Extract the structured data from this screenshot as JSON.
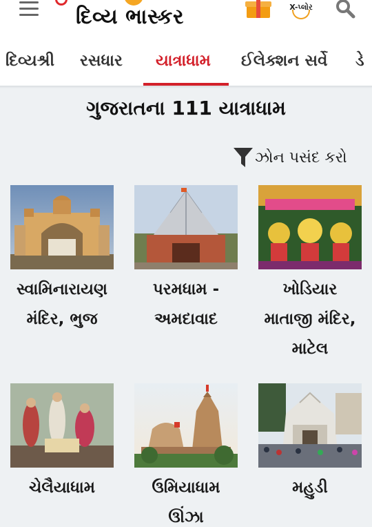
{
  "header": {
    "logo_text": "દિવ્ય ભાસ્કર",
    "xplore_text": "X-પ્લોર"
  },
  "tabs": [
    {
      "label": "દિવ્યશ્રી",
      "active": false
    },
    {
      "label": "રસધાર",
      "active": false
    },
    {
      "label": "યાત્રાધામ",
      "active": true
    },
    {
      "label": "ઈલેક્શન સર્વે",
      "active": false
    },
    {
      "label": "ડે",
      "active": false
    }
  ],
  "page": {
    "title": "ગુજરાતના 111 યાત્રાધામ",
    "filter_label": "ઝોન પસંદ કરો"
  },
  "temples": [
    {
      "line1": "સ્વામિનારાયણ",
      "line2": "મંદિર, ભુજ",
      "line3": ""
    },
    {
      "line1": "પરમધામ -",
      "line2": "અમદાવાદ",
      "line3": ""
    },
    {
      "line1": "ખોડિયાર",
      "line2": "માતાજી મંદિર,",
      "line3": "માટેલ"
    },
    {
      "line1": "ચેલૈયાધામ",
      "line2": "",
      "line3": ""
    },
    {
      "line1": "ઉમિયાધામ",
      "line2": "ઊંઝા",
      "line3": ""
    },
    {
      "line1": "મહુડી",
      "line2": "",
      "line3": ""
    }
  ],
  "colors": {
    "accent": "#d3202a",
    "background": "#eef1f3"
  }
}
